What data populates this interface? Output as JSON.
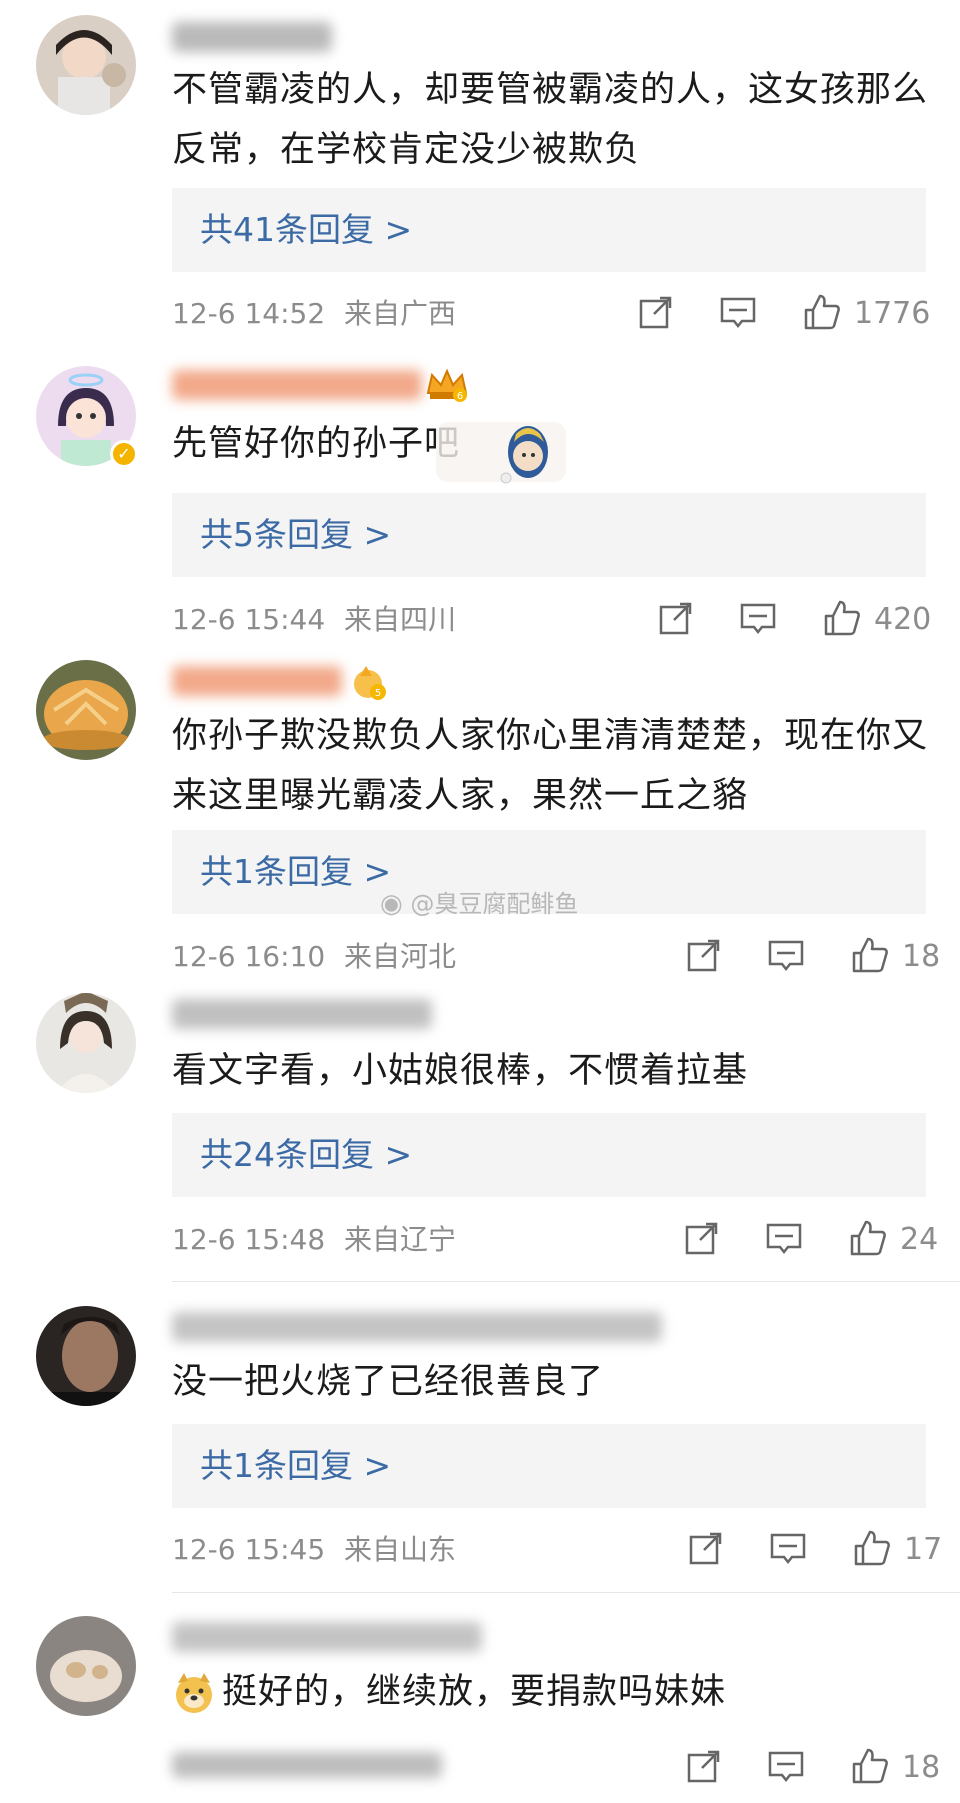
{
  "comments": [
    {
      "text": "不管霸凌的人，却要管被霸凌的人，这女孩那么反常，在学校肯定没少被欺负",
      "reply_label": "共41条回复 >",
      "time": "12-6 14:52",
      "location": "来自广西",
      "likes": "1776"
    },
    {
      "text": "先管好你的孙子吧",
      "reply_label": "共5条回复 >",
      "time": "12-6 15:44",
      "location": "来自四川",
      "likes": "420",
      "badge_level": "6"
    },
    {
      "text": "你孙子欺没欺负人家你心里清清楚楚，现在你又来这里曝光霸凌人家，果然一丘之貉",
      "reply_label": "共1条回复 >",
      "time": "12-6 16:10",
      "location": "来自河北",
      "likes": "18",
      "badge_level": "5"
    },
    {
      "text": "看文字看，小姑娘很棒，不惯着拉基",
      "reply_label": "共24条回复 >",
      "time": "12-6 15:48",
      "location": "来自辽宁",
      "likes": "24"
    },
    {
      "text": "没一把火烧了已经很善良了",
      "reply_label": "共1条回复 >",
      "time": "12-6 15:45",
      "location": "来自山东",
      "likes": "17"
    },
    {
      "text": "挺好的，继续放，要捐款吗妹妹",
      "likes": "18"
    }
  ],
  "watermark": "@臭豆腐配鲱鱼",
  "colors": {
    "link": "#3c6aa5",
    "meta": "#8c8c8c",
    "reply_bg": "#f4f4f4",
    "username_blur": "#f2a98a"
  }
}
